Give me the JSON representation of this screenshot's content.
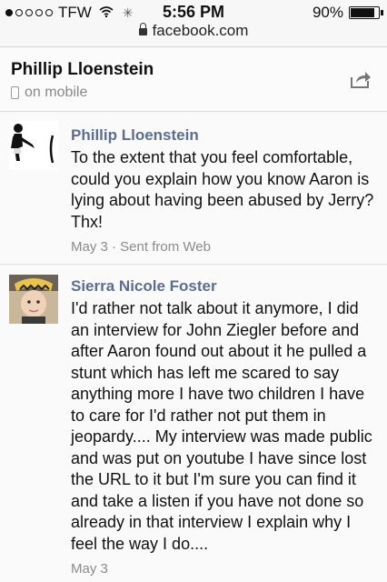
{
  "status_bar": {
    "carrier": "TFW",
    "time": "5:56 PM",
    "battery": "90%",
    "battery_level": 0.9
  },
  "url_bar": {
    "domain": "facebook.com"
  },
  "conversation": {
    "name": "Phillip Lloenstein",
    "status": "on mobile"
  },
  "messages": [
    {
      "sender": "Phillip Lloenstein",
      "text": "To the extent that you feel comfortable, could you explain how you know Aaron is lying about having been abused by Jerry? Thx!",
      "meta": "May 3 · Sent from Web"
    },
    {
      "sender": "Sierra Nicole Foster",
      "text": "I'd rather not talk about it anymore, I did an interview for John Ziegler before and after Aaron found out about it he pulled a stunt which has left me scared to say anything more I have two children I have to care for I'd rather not put them in jeopardy.... My interview was made public and was put on youtube I have since lost the URL to it but I'm sure you can find it and take a listen if you have not done so already in that interview I explain why I feel the way I do....",
      "meta": "May 3"
    }
  ],
  "icons": {
    "share": "share-icon",
    "lock": "lock-icon",
    "phone": "phone-icon",
    "wifi": "wifi-icon",
    "battery": "battery-icon"
  }
}
